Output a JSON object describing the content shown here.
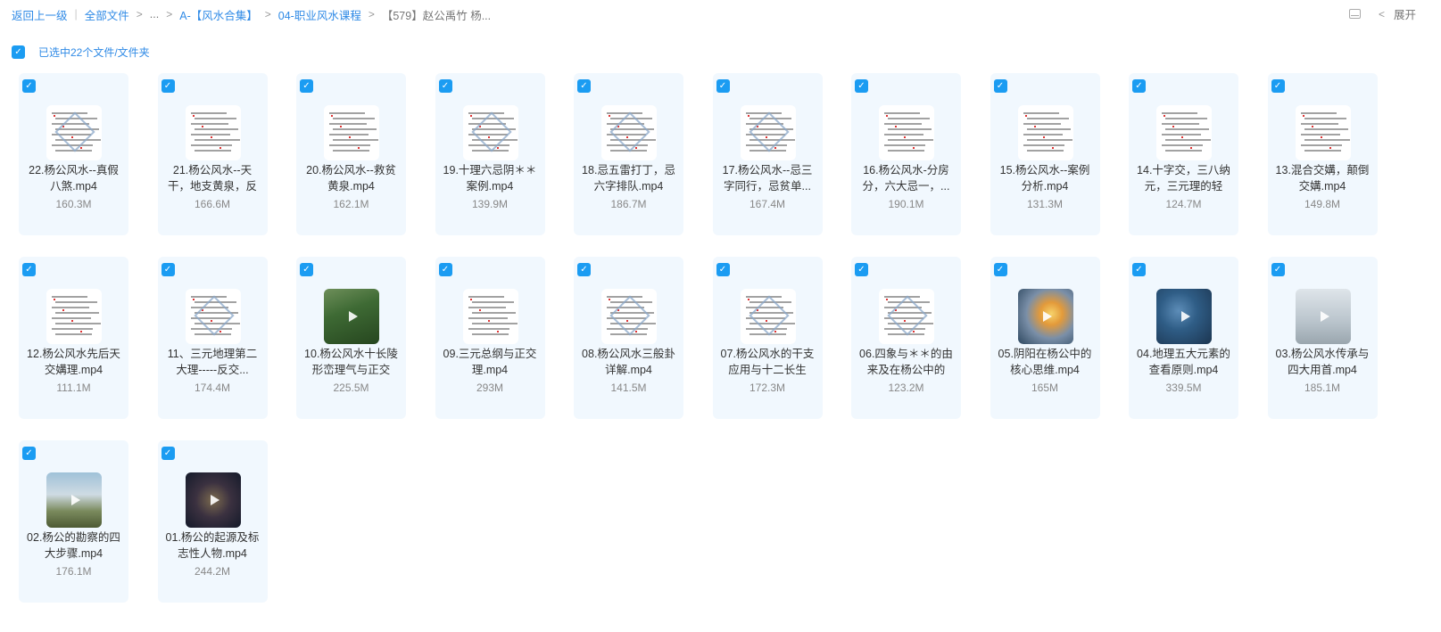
{
  "breadcrumb": {
    "back": "返回上一级",
    "all_files": "全部文件",
    "ellipsis": "...",
    "folder1": "A-【风水合集】",
    "folder2": "04-职业风水课程",
    "current": "【579】赵公禹竹 杨..."
  },
  "tools": {
    "layout_icon": "layout-icon",
    "collapse_icon": "chevron-left-icon",
    "expand_label": "展开"
  },
  "selection": {
    "label": "已选中22个文件/文件夹",
    "checked": true
  },
  "files": [
    {
      "name": "22.杨公风水--真假八煞.mp4",
      "size": "160.3M",
      "thumb": "doc-diagram"
    },
    {
      "name": "21.杨公风水--天干，地支黄泉，反",
      "size": "166.6M",
      "thumb": "doc"
    },
    {
      "name": "20.杨公风水--救贫黄泉.mp4",
      "size": "162.1M",
      "thumb": "doc"
    },
    {
      "name": "19.十理六忌阴＊＊案例.mp4",
      "size": "139.9M",
      "thumb": "doc-diagram"
    },
    {
      "name": "18.忌五雷打丁，忌六字排队.mp4",
      "size": "186.7M",
      "thumb": "doc-diagram"
    },
    {
      "name": "17.杨公风水--忌三字同行，忌贫单...",
      "size": "167.4M",
      "thumb": "doc-diagram"
    },
    {
      "name": "16.杨公风水-分房分，六大忌一，...",
      "size": "190.1M",
      "thumb": "doc"
    },
    {
      "name": "15.杨公风水--案例分析.mp4",
      "size": "131.3M",
      "thumb": "doc"
    },
    {
      "name": "14.十字交，三八纳元，三元理的轻",
      "size": "124.7M",
      "thumb": "doc"
    },
    {
      "name": "13.混合交媾，颠倒交媾.mp4",
      "size": "149.8M",
      "thumb": "doc"
    },
    {
      "name": "12.杨公风水先后天交媾理.mp4",
      "size": "111.1M",
      "thumb": "doc"
    },
    {
      "name": "11、三元地理第二大理-----反交...",
      "size": "174.4M",
      "thumb": "doc-diagram"
    },
    {
      "name": "10.杨公风水十长陵形峦理气与正交",
      "size": "225.5M",
      "thumb": "photo-green"
    },
    {
      "name": "09.三元总纲与正交理.mp4",
      "size": "293M",
      "thumb": "doc"
    },
    {
      "name": "08.杨公风水三般卦详解.mp4",
      "size": "141.5M",
      "thumb": "doc-diagram"
    },
    {
      "name": "07.杨公风水的干支应用与十二长生",
      "size": "172.3M",
      "thumb": "doc-diagram"
    },
    {
      "name": "06.四象与＊＊的由来及在杨公中的",
      "size": "123.2M",
      "thumb": "doc-diagram"
    },
    {
      "name": "05.阴阳在杨公中的核心思维.mp4",
      "size": "165M",
      "thumb": "photo-sun"
    },
    {
      "name": "04.地理五大元素的查看原则.mp4",
      "size": "339.5M",
      "thumb": "photo-earth"
    },
    {
      "name": "03.杨公风水传承与四大用首.mp4",
      "size": "185.1M",
      "thumb": "photo-person"
    },
    {
      "name": "02.杨公的勘察的四大步骤.mp4",
      "size": "176.1M",
      "thumb": "photo-mtn"
    },
    {
      "name": "01.杨公的起源及标志性人物.mp4",
      "size": "244.2M",
      "thumb": "photo-dark"
    }
  ]
}
